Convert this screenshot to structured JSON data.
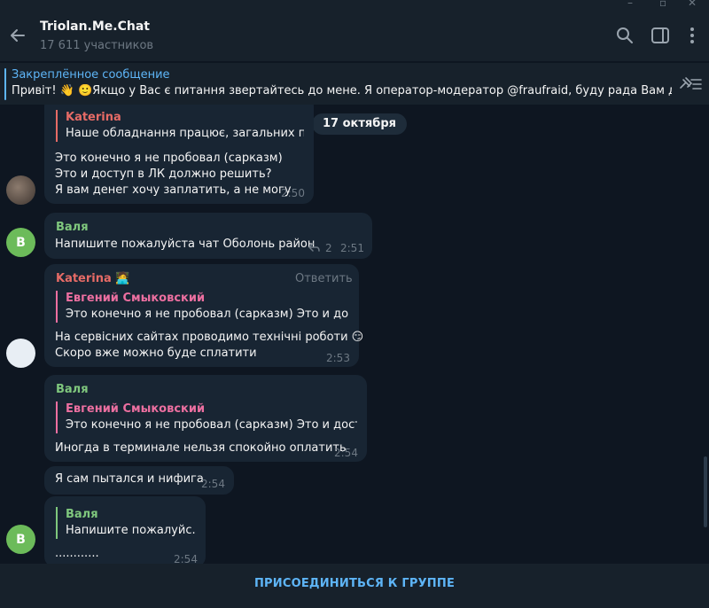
{
  "chat": {
    "title": "Triolan.Me.Chat",
    "members": "17 611 участников"
  },
  "pinned": {
    "label": "Закреплённое сообщение",
    "text": "Привіт! 👋 🙂Якщо у Вас є питання звертайтесь до мене. Я оператор-модератор @fraufraid, буду рада Вам допо..."
  },
  "date_separator": "17 октября",
  "messages": [
    {
      "reply_name": "Katerina",
      "reply_text": "Наше обладнання працює,  загальних п...",
      "lines": [
        "Это конечно я не пробовал (сарказм)",
        "Это и доступ в ЛК должно решить?",
        "Я вам денег хочу заплатить, а не могу"
      ],
      "time": "2:50"
    },
    {
      "sender": "Валя",
      "avatar_letter": "В",
      "text": "Напишите пожалуйста чат Оболонь район",
      "replies_count": "2",
      "time": "2:51"
    },
    {
      "sender": "Katerina",
      "reply_action": "Ответить",
      "reply_name": "Евгений Смыковский",
      "reply_text": "Это конечно я не пробовал (сарказм) Это и дост...",
      "lines": [
        "На сервісних сайтах проводимо технічні роботи 😏",
        "Скоро вже можно буде сплатити"
      ],
      "time": "2:53"
    },
    {
      "sender": "Валя",
      "reply_name": "Евгений Смыковский",
      "reply_text": "Это конечно я не пробовал (сарказм) Это и досту...",
      "text": "Иногда в терминале нельзя спокойно оплатить",
      "time": "2:54"
    },
    {
      "text": "Я сам пытался и нифига",
      "time": "2:54"
    },
    {
      "reply_name": "Валя",
      "reply_text": "Напишите пожалуйс...",
      "text": "............",
      "time": "2:54",
      "avatar_letter": "В"
    }
  ],
  "join_label": "ПРИСОЕДИНИТЬСЯ К ГРУППЕ",
  "colors": {
    "background": "#0e1621",
    "header": "#17212b",
    "bubble": "#182533",
    "accent": "#5eb5f7",
    "katerina": "#e66b66",
    "valya": "#7fc77d",
    "evgeniy": "#ec6fa0"
  },
  "icons": [
    "back-arrow-icon",
    "search-icon",
    "sidebar-toggle-icon",
    "more-vertical-icon",
    "unpin-list-icon",
    "reply-count-icon"
  ]
}
